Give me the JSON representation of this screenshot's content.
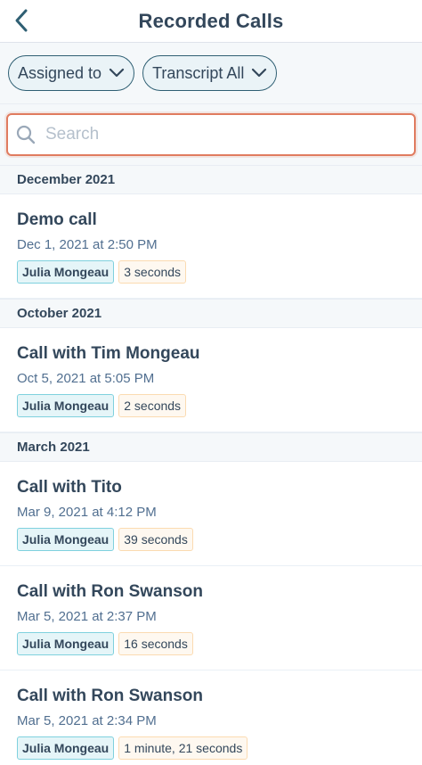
{
  "header": {
    "title": "Recorded Calls",
    "back_icon": "chevron-left-icon"
  },
  "filters": {
    "assigned_label": "Assigned to",
    "transcript_label": "Transcript All"
  },
  "search": {
    "placeholder": "Search",
    "value": ""
  },
  "colors": {
    "accent": "#2f5f73",
    "search_border": "#e07b5f",
    "text": "#33475b",
    "section_bg": "#f5f8fa",
    "user_tag_bg": "#e5f5f8",
    "duration_tag_bg": "#fef8f0"
  },
  "sections": [
    {
      "title": "December 2021",
      "calls": [
        {
          "title": "Demo call",
          "date": "Dec 1, 2021 at 2:50 PM",
          "user": "Julia Mongeau",
          "duration": "3 seconds"
        }
      ]
    },
    {
      "title": "October 2021",
      "calls": [
        {
          "title": "Call with Tim Mongeau",
          "date": "Oct 5, 2021 at 5:05 PM",
          "user": "Julia Mongeau",
          "duration": "2 seconds"
        }
      ]
    },
    {
      "title": "March 2021",
      "calls": [
        {
          "title": "Call with Tito",
          "date": "Mar 9, 2021 at 4:12 PM",
          "user": "Julia Mongeau",
          "duration": "39 seconds"
        },
        {
          "title": "Call with Ron Swanson",
          "date": "Mar 5, 2021 at 2:37 PM",
          "user": "Julia Mongeau",
          "duration": "16 seconds"
        },
        {
          "title": "Call with Ron Swanson",
          "date": "Mar 5, 2021 at 2:34 PM",
          "user": "Julia Mongeau",
          "duration": "1 minute, 21 seconds"
        }
      ]
    }
  ]
}
